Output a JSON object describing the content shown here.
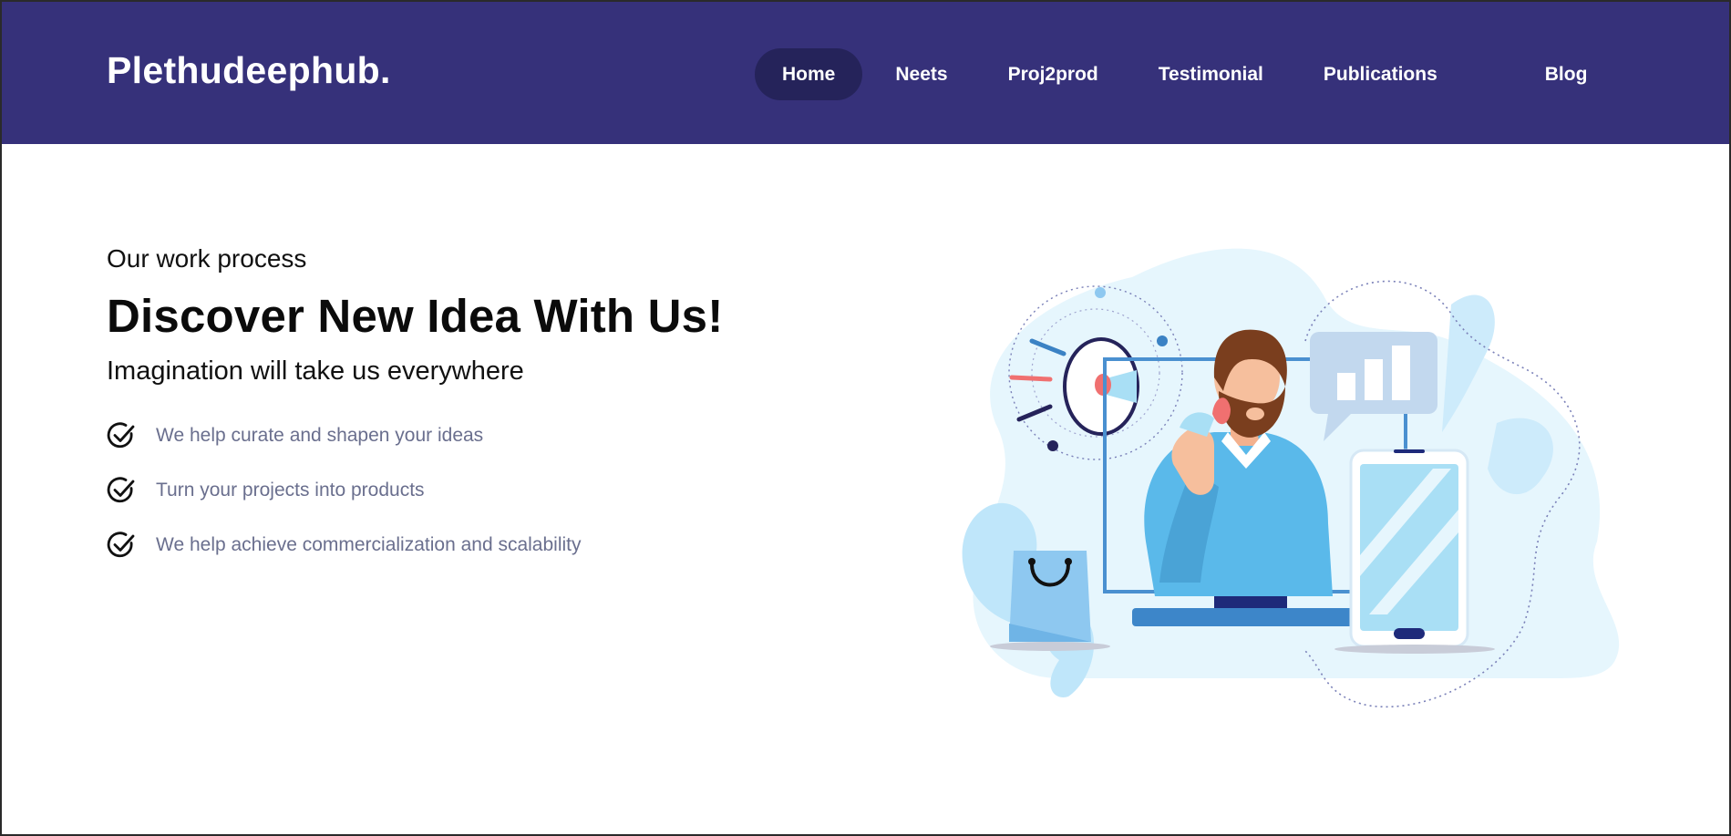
{
  "brand": {
    "name": "Plethudeephub."
  },
  "nav": {
    "items": [
      {
        "label": "Home",
        "active": true
      },
      {
        "label": "Neets",
        "active": false
      },
      {
        "label": "Proj2prod",
        "active": false
      },
      {
        "label": "Testimonial",
        "active": false
      },
      {
        "label": "Publications",
        "active": false
      },
      {
        "label": "Blog",
        "active": false
      }
    ]
  },
  "hero": {
    "eyebrow": "Our work process",
    "headline": "Discover New Idea With Us!",
    "tagline": "Imagination will take us everywhere",
    "features": [
      {
        "icon": "check-circle-icon",
        "text": "We help curate and shapen your ideas"
      },
      {
        "icon": "check-circle-icon",
        "text": "Turn your projects into products"
      },
      {
        "icon": "check-circle-icon",
        "text": "We help achieve commercialization and scalability"
      }
    ],
    "illustration": "marketing-megaphone-illustration"
  },
  "colors": {
    "navbar_bg": "#36317a",
    "active_pill": "#25235a",
    "feature_text": "#6a6f8e",
    "illustration_light": "#e5f5fd",
    "illustration_blue": "#5ab9ea"
  }
}
